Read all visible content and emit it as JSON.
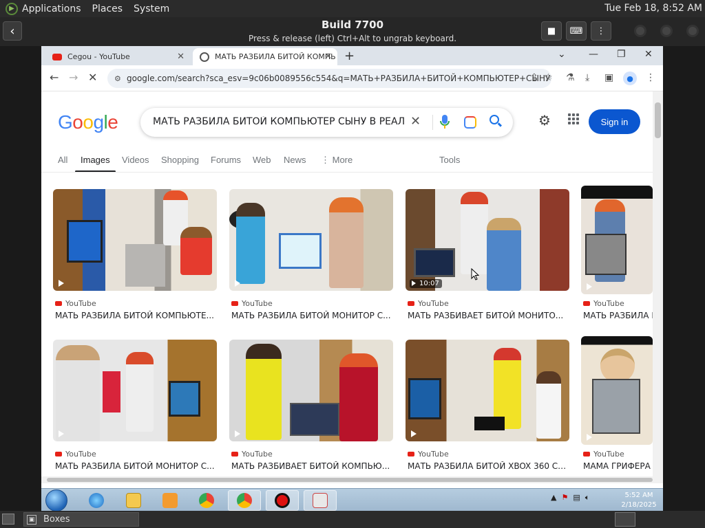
{
  "topbar": {
    "menus": [
      "Applications",
      "Places",
      "System"
    ],
    "datetime": "Tue Feb 18,  8:52 AM"
  },
  "boxes": {
    "title": "Build 7700",
    "subtitle": "Press & release (left) Ctrl+Alt to ungrab keyboard."
  },
  "chrome": {
    "tabs": [
      {
        "label": "Cegou - YouTube",
        "icon": "youtube-icon"
      },
      {
        "label": "МАТЬ РАЗБИЛА БИТОЙ КОМПЬ",
        "icon": "loading-icon"
      }
    ],
    "url": "google.com/search?sca_esv=9c06b0089556c554&q=МАТЬ+РАЗБИЛА+БИТОЙ+КОМПЬЮТЕР+СЫНУ+..."
  },
  "google": {
    "query": "МАТЬ РАЗБИЛА БИТОЙ КОМПЬЮТЕР СЫНУ В РЕАЛЬ",
    "signin": "Sign in",
    "filters": [
      "All",
      "Images",
      "Videos",
      "Shopping",
      "Forums",
      "Web",
      "News",
      "More",
      "Tools"
    ],
    "active_filter": "Images",
    "results": [
      {
        "source": "YouTube",
        "title": "МАТЬ РАЗБИЛА БИТОЙ КОМПЬЮТЕ..."
      },
      {
        "source": "YouTube",
        "title": "МАТЬ РАЗБИЛА БИТОЙ МОНИТОР С..."
      },
      {
        "source": "YouTube",
        "title": "МАТЬ РАЗБИВАЕТ БИТОЙ МОНИТО...",
        "duration": "10:07"
      },
      {
        "source": "YouTube",
        "title": "МАТЬ РАЗБИЛА Б"
      },
      {
        "source": "YouTube",
        "title": "МАТЬ РАЗБИЛА БИТОЙ МОНИТОР С..."
      },
      {
        "source": "YouTube",
        "title": "МАТЬ РАЗБИВАЕТ БИТОЙ КОМПЬЮ..."
      },
      {
        "source": "YouTube",
        "title": "МАТЬ РАЗБИЛА БИТОЙ XBOX 360 СВ..."
      },
      {
        "source": "YouTube",
        "title": "МАМА ГРИФЕРА"
      }
    ]
  },
  "taskbar": {
    "clock_time": "5:52 AM",
    "clock_date": "2/18/2025"
  },
  "bottombar": {
    "label": "Boxes"
  },
  "colors": {
    "google_blue": "#4285f4",
    "google_red": "#ea4335",
    "google_yellow": "#fbbc05",
    "google_green": "#34a853",
    "signin_bg": "#0b57d0"
  }
}
